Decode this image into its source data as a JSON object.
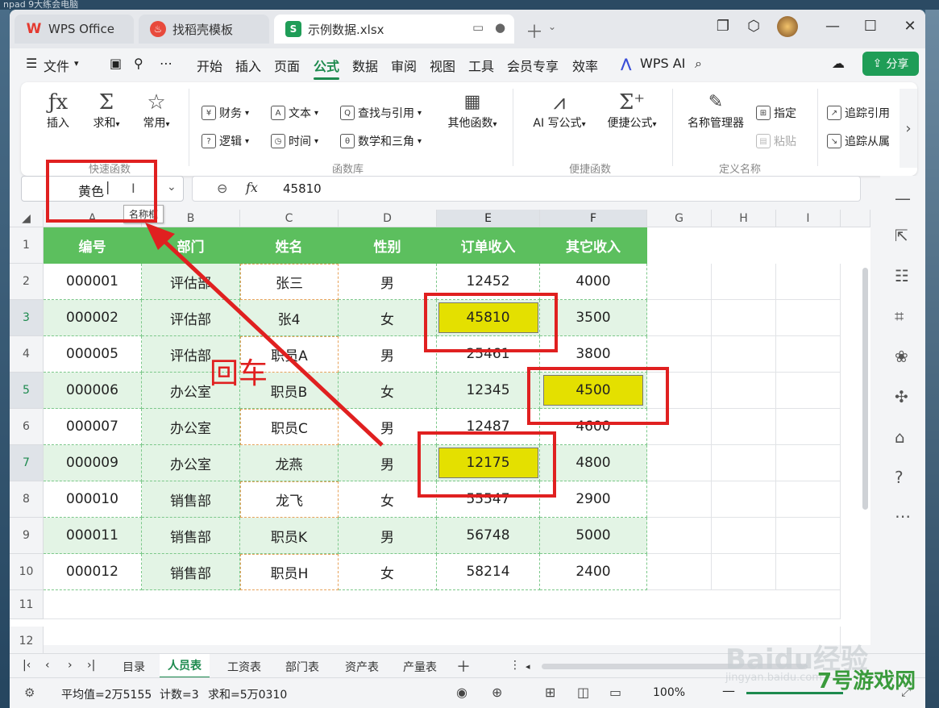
{
  "desktop": {
    "top_text": "npad   9大练会电脑"
  },
  "tabs": [
    {
      "label": "WPS Office"
    },
    {
      "label": "找稻壳模板"
    },
    {
      "label": "示例数据.xlsx"
    }
  ],
  "menu": {
    "file": "文件",
    "items": [
      "开始",
      "插入",
      "页面",
      "公式",
      "数据",
      "审阅",
      "视图",
      "工具",
      "会员专享",
      "效率"
    ],
    "active": "公式",
    "ai": "WPS AI",
    "share": "分享"
  },
  "ribbon": {
    "insert": "插入",
    "sum": "求和",
    "common": "常用",
    "quick_fn": "快速函数",
    "finance": "财务",
    "text": "文本",
    "lookup": "查找与引用",
    "logic": "逻辑",
    "time": "时间",
    "math": "数学和三角",
    "other": "其他函数",
    "fn_lib": "函数库",
    "ai_formula": "AI 写公式",
    "quick_formula": "便捷公式",
    "conv_fn": "便捷函数",
    "name_mgr": "名称管理器",
    "specify": "指定",
    "paste": "粘贴",
    "def_name": "定义名称",
    "trace_pre": "追踪引用",
    "trace_dep": "追踪从属"
  },
  "formula_bar": {
    "name_box_value": "黄色",
    "tooltip": "名称框",
    "fx": "fx",
    "value": "45810"
  },
  "columns": [
    "A",
    "B",
    "C",
    "D",
    "E",
    "F",
    "G",
    "H",
    "I"
  ],
  "row_numbers": [
    "1",
    "2",
    "3",
    "4",
    "5",
    "6",
    "7",
    "8",
    "9",
    "10",
    "11",
    "12"
  ],
  "table": {
    "headers": [
      "编号",
      "部门",
      "姓名",
      "性别",
      "订单收入",
      "其它收入"
    ],
    "rows": [
      [
        "000001",
        "评估部",
        "张三",
        "男",
        "12452",
        "4000"
      ],
      [
        "000002",
        "评估部",
        "张4",
        "女",
        "45810",
        "3500"
      ],
      [
        "000005",
        "评估部",
        "职员A",
        "男",
        "25461",
        "3800"
      ],
      [
        "000006",
        "办公室",
        "职员B",
        "女",
        "12345",
        "4500"
      ],
      [
        "000007",
        "办公室",
        "职员C",
        "男",
        "12487",
        "4600"
      ],
      [
        "000009",
        "办公室",
        "龙燕",
        "男",
        "12175",
        "4800"
      ],
      [
        "000010",
        "销售部",
        "龙飞",
        "女",
        "55547",
        "2900"
      ],
      [
        "000011",
        "销售部",
        "职员K",
        "男",
        "56748",
        "5000"
      ],
      [
        "000012",
        "销售部",
        "职员H",
        "女",
        "58214",
        "2400"
      ]
    ]
  },
  "annotation": {
    "text": "回车",
    "color": "#e02020"
  },
  "highlight_color": "#e4e000",
  "sheet_tabs": [
    "目录",
    "人员表",
    "工资表",
    "部门表",
    "资产表",
    "产量表"
  ],
  "active_sheet": "人员表",
  "status": {
    "avg": "平均值=2万5155",
    "count": "计数=3",
    "sum": "求和=5万0310",
    "zoom": "100%"
  },
  "watermark": {
    "text": "Baidu经验",
    "sub": "jingyan.baidu.com",
    "logo": "7号游戏网"
  }
}
